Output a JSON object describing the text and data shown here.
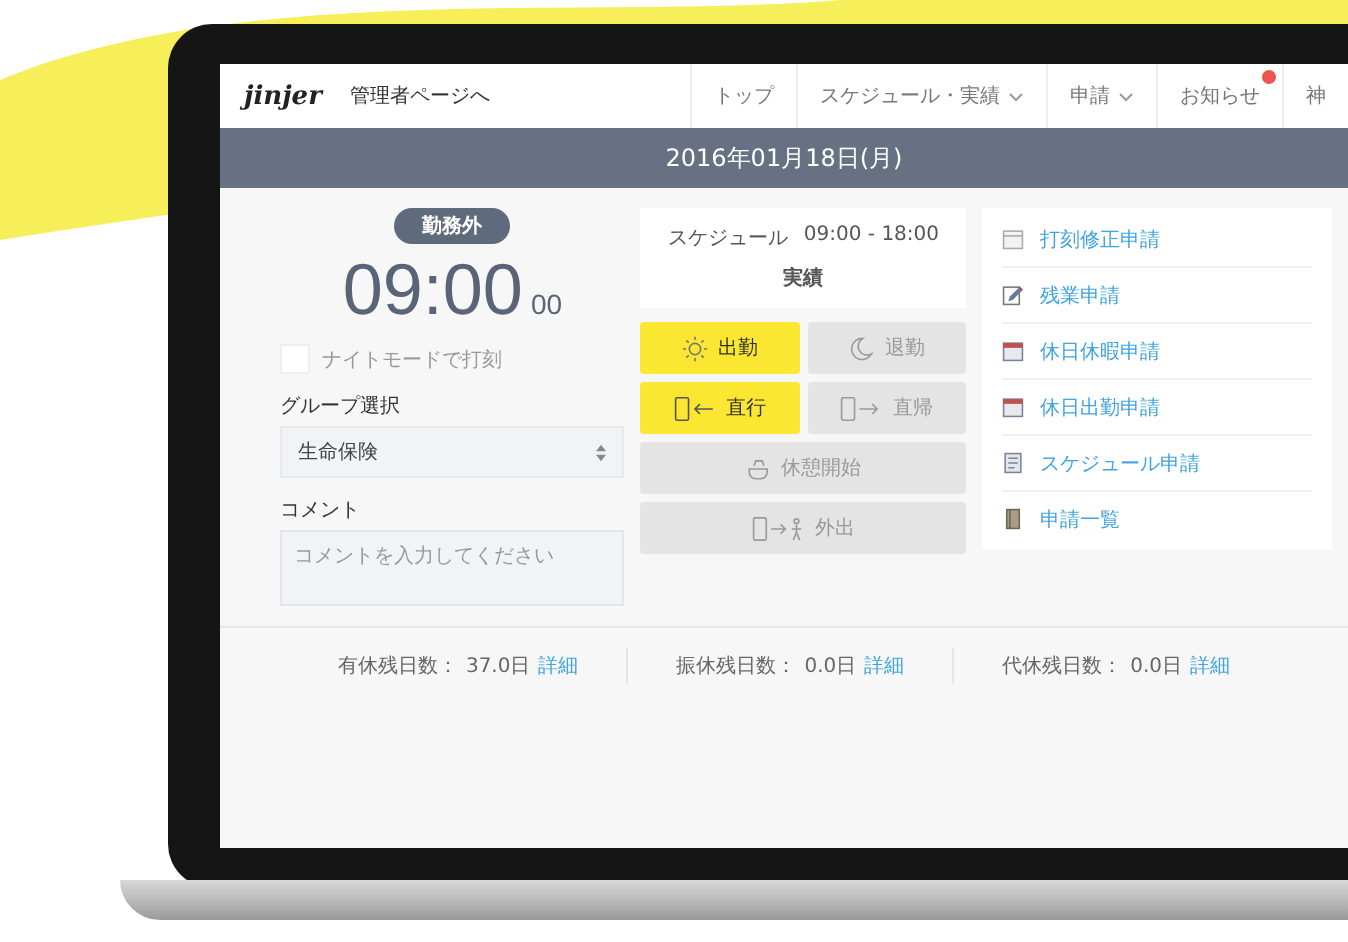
{
  "header": {
    "logo": "jinjer",
    "admin_link": "管理者ページへ",
    "nav": [
      {
        "label": "トップ",
        "dropdown": false,
        "badge": false
      },
      {
        "label": "スケジュール・実績",
        "dropdown": true,
        "badge": false
      },
      {
        "label": "申請",
        "dropdown": true,
        "badge": false
      },
      {
        "label": "お知らせ",
        "dropdown": false,
        "badge": true
      },
      {
        "label": "神",
        "dropdown": false,
        "badge": false
      }
    ]
  },
  "date": "2016年01月18日(月)",
  "status": "勤務外",
  "clock": {
    "time": "09:00",
    "seconds": "00"
  },
  "night_mode": {
    "label": "ナイトモードで打刻",
    "checked": false
  },
  "group": {
    "label": "グループ選択",
    "value": "生命保険"
  },
  "comment": {
    "label": "コメント",
    "placeholder": "コメントを入力してください"
  },
  "schedule": {
    "label": "スケジュール",
    "time": "09:00 - 18:00",
    "note": "実績"
  },
  "punch_buttons": [
    {
      "label": "出勤",
      "kind": "sun",
      "enabled": true
    },
    {
      "label": "退勤",
      "kind": "moon",
      "enabled": false
    },
    {
      "label": "直行",
      "kind": "arrive",
      "enabled": true
    },
    {
      "label": "直帰",
      "kind": "leave",
      "enabled": false
    },
    {
      "label": "休憩開始",
      "kind": "break",
      "enabled": false
    },
    {
      "label": "外出",
      "kind": "out",
      "enabled": false
    }
  ],
  "requests": [
    {
      "label": "打刻修正申請",
      "kind": "calendar"
    },
    {
      "label": "残業申請",
      "kind": "pencil"
    },
    {
      "label": "休日休暇申請",
      "kind": "red-calendar"
    },
    {
      "label": "休日出勤申請",
      "kind": "red-calendar"
    },
    {
      "label": "スケジュール申請",
      "kind": "document"
    },
    {
      "label": "申請一覧",
      "kind": "book"
    }
  ],
  "balances": [
    {
      "label": "有休残日数：",
      "value": "37.0日",
      "link": "詳細"
    },
    {
      "label": "振休残日数：",
      "value": "0.0日",
      "link": "詳細"
    },
    {
      "label": "代休残日数：",
      "value": "0.0日",
      "link": "詳細"
    }
  ]
}
